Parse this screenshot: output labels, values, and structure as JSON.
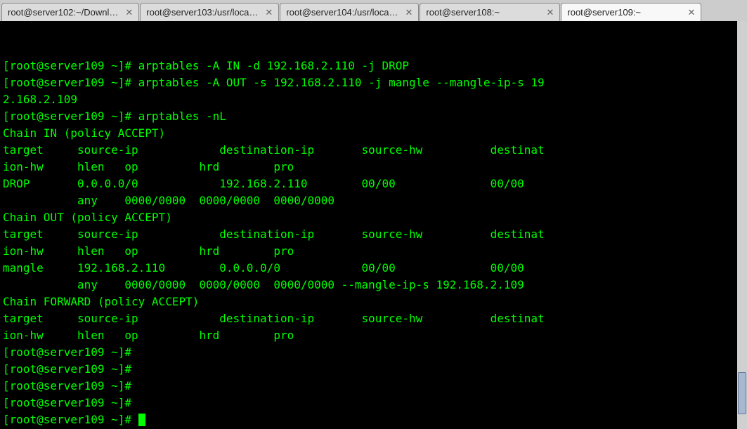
{
  "tabs": [
    {
      "label": "root@server102:~/Downl…",
      "active": false
    },
    {
      "label": "root@server103:/usr/loca…",
      "active": false
    },
    {
      "label": "root@server104:/usr/loca…",
      "active": false
    },
    {
      "label": "root@server108:~",
      "active": false
    },
    {
      "label": "root@server109:~",
      "active": true
    }
  ],
  "terminal_lines": [
    {
      "prompt": "[root@server109 ~]# ",
      "cmd": "arptables -A IN -d 192.168.2.110 -j DROP"
    },
    {
      "prompt": "[root@server109 ~]# ",
      "cmd": "arptables -A OUT -s 192.168.2.110 -j mangle --mangle-ip-s 19"
    },
    {
      "prompt": "",
      "cmd": "2.168.2.109"
    },
    {
      "prompt": "[root@server109 ~]# ",
      "cmd": "arptables -nL"
    },
    {
      "prompt": "",
      "cmd": "Chain IN (policy ACCEPT)"
    },
    {
      "prompt": "",
      "cmd": "target     source-ip            destination-ip       source-hw          destinat"
    },
    {
      "prompt": "",
      "cmd": "ion-hw     hlen   op         hrd        pro"
    },
    {
      "prompt": "",
      "cmd": "DROP       0.0.0.0/0            192.168.2.110        00/00              00/00"
    },
    {
      "prompt": "",
      "cmd": "           any    0000/0000  0000/0000  0000/0000"
    },
    {
      "prompt": "",
      "cmd": ""
    },
    {
      "prompt": "",
      "cmd": "Chain OUT (policy ACCEPT)"
    },
    {
      "prompt": "",
      "cmd": "target     source-ip            destination-ip       source-hw          destinat"
    },
    {
      "prompt": "",
      "cmd": "ion-hw     hlen   op         hrd        pro"
    },
    {
      "prompt": "",
      "cmd": "mangle     192.168.2.110        0.0.0.0/0            00/00              00/00"
    },
    {
      "prompt": "",
      "cmd": "           any    0000/0000  0000/0000  0000/0000 --mangle-ip-s 192.168.2.109"
    },
    {
      "prompt": "",
      "cmd": ""
    },
    {
      "prompt": "",
      "cmd": "Chain FORWARD (policy ACCEPT)"
    },
    {
      "prompt": "",
      "cmd": "target     source-ip            destination-ip       source-hw          destinat"
    },
    {
      "prompt": "",
      "cmd": "ion-hw     hlen   op         hrd        pro"
    },
    {
      "prompt": "[root@server109 ~]# ",
      "cmd": ""
    },
    {
      "prompt": "[root@server109 ~]# ",
      "cmd": ""
    },
    {
      "prompt": "[root@server109 ~]# ",
      "cmd": ""
    },
    {
      "prompt": "[root@server109 ~]# ",
      "cmd": ""
    },
    {
      "prompt": "[root@server109 ~]# ",
      "cmd": "",
      "cursor": true
    }
  ]
}
